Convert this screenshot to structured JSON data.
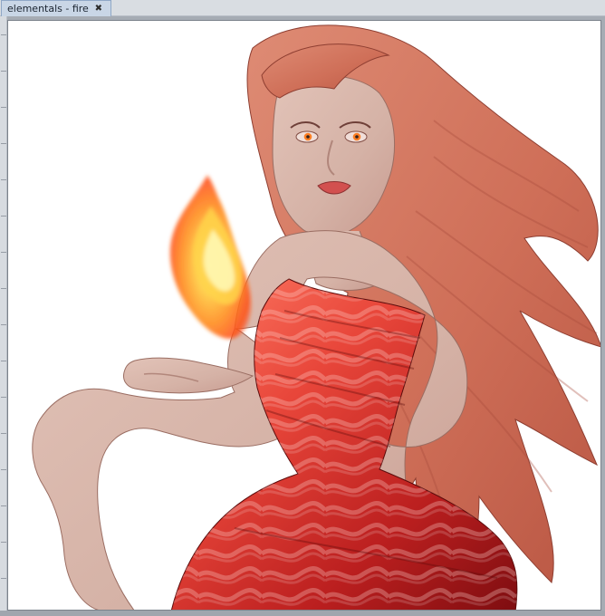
{
  "document_tab": {
    "title": "elementals - fire",
    "close_glyph": "✖"
  },
  "canvas": {
    "background": "#ffffff",
    "artwork": {
      "subject_palette": {
        "hair": "#d27a63",
        "skin": "#d9b7ab",
        "skin_shadow": "#c79f93",
        "dress_light": "#ff6a4f",
        "dress_mid": "#d3392a",
        "dress_dark": "#8f0f12",
        "fire_core": "#ffef5a",
        "fire_mid": "#ff9b1a",
        "fire_outer": "#ff4b12"
      }
    }
  },
  "icons": {
    "close_icon": "close-icon"
  }
}
